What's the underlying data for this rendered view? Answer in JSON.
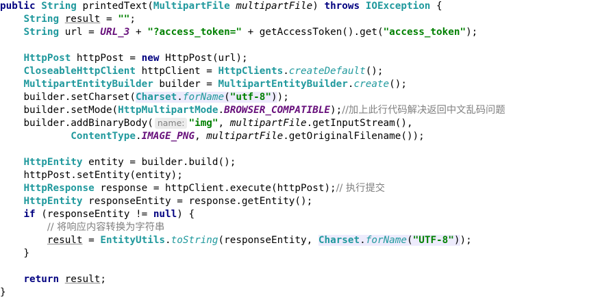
{
  "code_lines": [
    "public String printedText(MultipartFile multipartFile) throws IOException {",
    "    String result = \"\";",
    "    String url = URL_3 + \"?access_token=\" + getAccessToken().get(\"access_token\");",
    "",
    "    HttpPost httpPost = new HttpPost(url);",
    "    CloseableHttpClient httpClient = HttpClients.createDefault();",
    "    MultipartEntityBuilder builder = MultipartEntityBuilder.create();",
    "    builder.setCharset(Charset.forName(\"utf-8\"));",
    "    builder.setMode(HttpMultipartMode.BROWSER_COMPATIBLE);//加上此行代码解决返回中文乱码问题",
    "    builder.addBinaryBody( name: \"img\", multipartFile.getInputStream(),",
    "            ContentType.IMAGE_PNG, multipartFile.getOriginalFilename());",
    "",
    "    HttpEntity entity = builder.build();",
    "    httpPost.setEntity(entity);",
    "    HttpResponse response = httpClient.execute(httpPost);// 执行提交",
    "    HttpEntity responseEntity = response.getEntity();",
    "    if (responseEntity != null) {",
    "        // 将响应应内容转换为字符串",
    "        result = EntityUtils.toString(responseEntity, Charset.forName(\"UTF-8\"));",
    "    }",
    "",
    "    return result;",
    "}"
  ],
  "tokens": {
    "public": "public",
    "String": "String",
    "printedText": "printedText(",
    "MultipartFile": "MultipartFile",
    "multipartFile": "multipartFile",
    "throws": "throws",
    "IOException": "IOException",
    "result": "result",
    "empty_str": "\"\"",
    "url": "url",
    "URL_3": "URL_3",
    "access_token_q": "\"?access_token=\"",
    "getAccessToken": "getAccessToken().get(",
    "access_token": "\"access_token\"",
    "HttpPost": "HttpPost",
    "httpPost": "httpPost",
    "new": "new",
    "CloseableHttpClient": "CloseableHttpClient",
    "httpClient": "httpClient",
    "HttpClients": "HttpClients",
    "createDefault": "createDefault",
    "MultipartEntityBuilder": "MultipartEntityBuilder",
    "builder": "builder",
    "create": "create",
    "setCharset": "builder.setCharset(",
    "Charset": "Charset",
    "forName": "forName",
    "utf8": "\"utf-8\"",
    "setMode": "builder.setMode(",
    "HttpMultipartMode": "HttpMultipartMode",
    "BROWSER_COMPATIBLE": "BROWSER_COMPATIBLE",
    "comment_mode": "//加上此行代码解决返回中文乱码问题",
    "addBinaryBody": "builder.addBinaryBody(",
    "hint_name": "name:",
    "img": "\"img\"",
    "getInputStream": ".getInputStream(),",
    "ContentType": "ContentType",
    "IMAGE_PNG": "IMAGE_PNG",
    "getOriginalFilename": ".getOriginalFilename());",
    "HttpEntity": "HttpEntity",
    "entity": "entity",
    "build": "builder.build();",
    "setEntity": "httpPost.setEntity(entity);",
    "HttpResponse": "HttpResponse",
    "response": "response",
    "execute": "httpClient.execute(httpPost);",
    "comment_exec": "// 执行提交",
    "responseEntity": "responseEntity",
    "getEntity": "response.getEntity();",
    "if": "if",
    "null": "null",
    "comment_convert": "// 将响应内容转换为字符串",
    "EntityUtils": "EntityUtils",
    "toString": "toString",
    "UTF8": "\"UTF-8\"",
    "return": "return"
  }
}
